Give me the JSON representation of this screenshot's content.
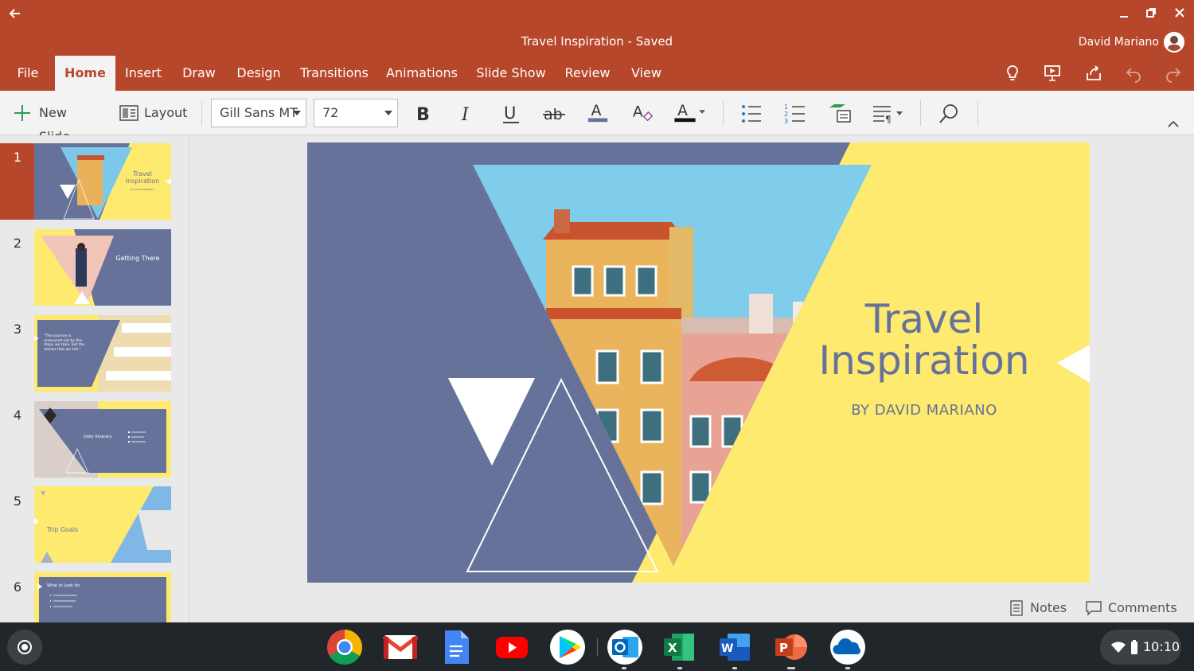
{
  "window": {
    "doc_title": "Travel Inspiration - Saved",
    "user_name": "David Mariano"
  },
  "tabs": [
    {
      "label": "File"
    },
    {
      "label": "Home",
      "active": true
    },
    {
      "label": "Insert"
    },
    {
      "label": "Draw"
    },
    {
      "label": "Design"
    },
    {
      "label": "Transitions"
    },
    {
      "label": "Animations"
    },
    {
      "label": "Slide Show"
    },
    {
      "label": "Review"
    },
    {
      "label": "View"
    }
  ],
  "toolbar": {
    "new_slide": "New Slide",
    "layout": "Layout",
    "font_name": "Gill Sans MT",
    "font_size": "72"
  },
  "thumbnails": [
    {
      "num": "1",
      "title": "Travel Inspiration",
      "sub": "BY DAVID MARIANO",
      "selected": true
    },
    {
      "num": "2",
      "title": "Getting There"
    },
    {
      "num": "3",
      "title": "\"The journey is measured not by the steps we take, but the stories that we tell.\""
    },
    {
      "num": "4",
      "title": "Daily Itinerary"
    },
    {
      "num": "5",
      "title": "Trip Goals"
    },
    {
      "num": "6",
      "title": "What to Look for"
    }
  ],
  "slide": {
    "title_line1": "Travel",
    "title_line2": "Inspiration",
    "subtitle": "BY DAVID MARIANO"
  },
  "bottom": {
    "notes": "Notes",
    "comments": "Comments"
  },
  "taskbar": {
    "time": "10:10",
    "apps": [
      "chrome-icon",
      "gmail-icon",
      "docs-icon",
      "youtube-icon",
      "play-store-icon",
      "outlook-icon",
      "excel-icon",
      "word-icon",
      "powerpoint-icon",
      "onedrive-icon"
    ]
  },
  "colors": {
    "brand": "#b7472a",
    "slide_blue": "#67729a",
    "slide_yellow": "#fdea6e"
  }
}
